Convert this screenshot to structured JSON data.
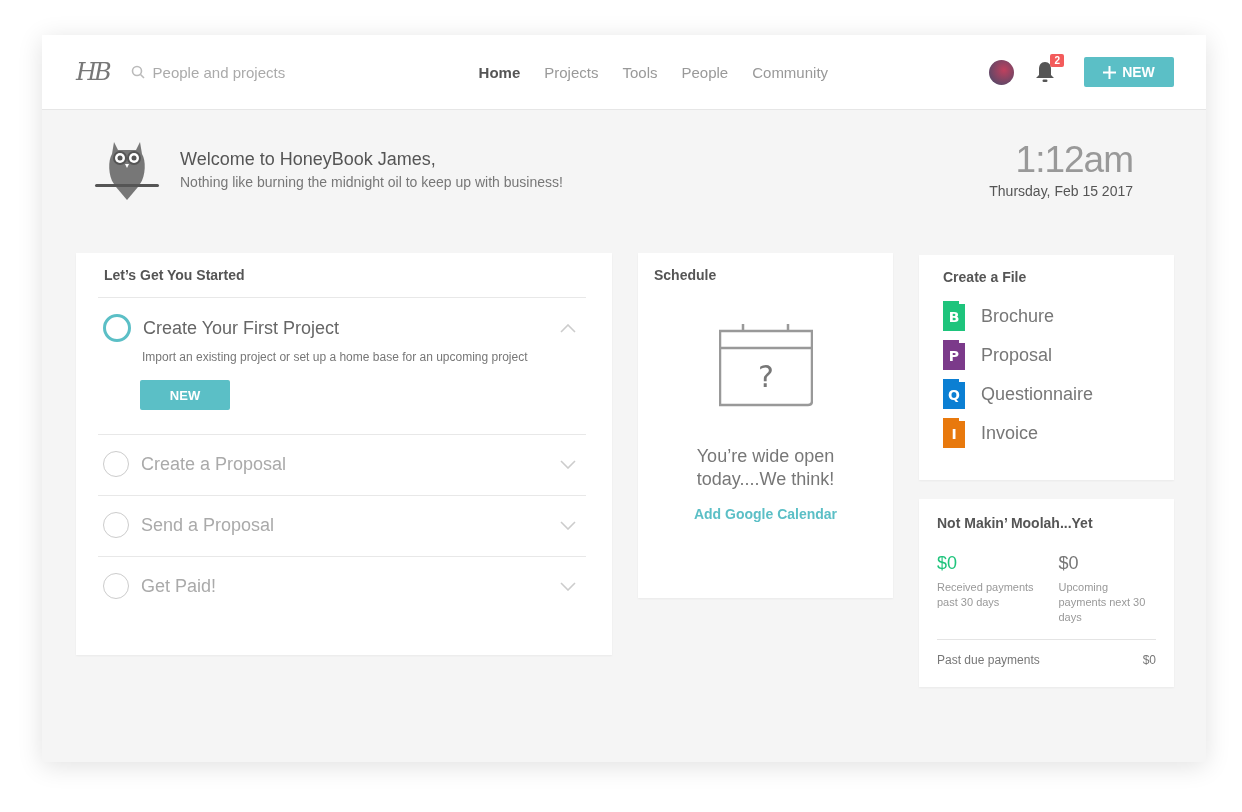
{
  "header": {
    "logo": "HB",
    "search": {
      "placeholder": "People and projects"
    },
    "nav": [
      {
        "label": "Home",
        "selected": true
      },
      {
        "label": "Projects",
        "selected": false
      },
      {
        "label": "Tools",
        "selected": false
      },
      {
        "label": "People",
        "selected": false
      },
      {
        "label": "Community",
        "selected": false
      }
    ],
    "notifications": "2",
    "new_button": "NEW"
  },
  "welcome": {
    "title": "Welcome to HoneyBook James,",
    "subtitle": "Nothing like burning the midnight oil to keep up with business!",
    "time": "1:12am",
    "date": "Thursday, Feb 15 2017"
  },
  "started": {
    "title": "Let’s Get You Started",
    "steps": [
      {
        "title": "Create Your First Project",
        "expanded": true,
        "description": "Import an existing project or set up a home base for an upcoming project",
        "button": "NEW"
      },
      {
        "title": "Create a Proposal",
        "expanded": false
      },
      {
        "title": "Send a Proposal",
        "expanded": false
      },
      {
        "title": "Get Paid!",
        "expanded": false
      }
    ]
  },
  "schedule": {
    "title": "Schedule",
    "calendar_mark": "?",
    "message": "You’re wide open today....We think!",
    "link": "Add Google Calendar"
  },
  "create_file": {
    "title": "Create a File",
    "files": [
      {
        "letter": "B",
        "label": "Brochure",
        "color": "#1ec47c"
      },
      {
        "letter": "P",
        "label": "Proposal",
        "color": "#7b3a8a"
      },
      {
        "letter": "Q",
        "label": "Questionnaire",
        "color": "#0b7fd3"
      },
      {
        "letter": "I",
        "label": "Invoice",
        "color": "#e8790d"
      }
    ]
  },
  "money": {
    "title": "Not Makin’ Moolah...Yet",
    "stats": [
      {
        "amount": "$0",
        "color": "#1ec47c",
        "label": "Received payments past 30 days"
      },
      {
        "amount": "$0",
        "color": "#777777",
        "label": "Upcoming payments next 30 days"
      }
    ],
    "past_due": {
      "label": "Past due payments",
      "amount": "$0"
    }
  }
}
